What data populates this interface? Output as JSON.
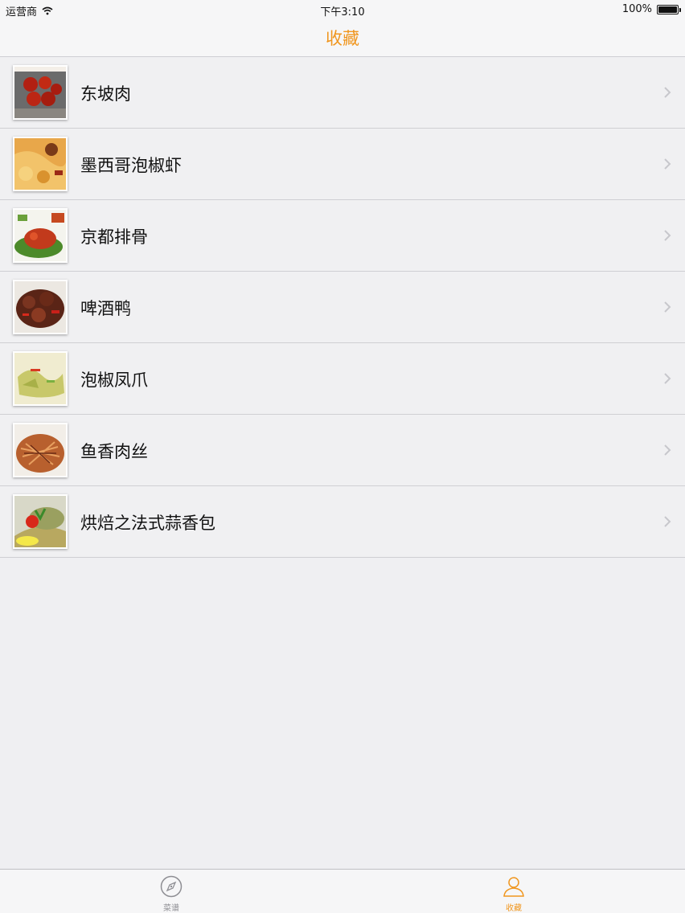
{
  "status_bar": {
    "carrier": "运营商",
    "time": "下午3:10",
    "battery_text": "100%",
    "battery_level": 1.0
  },
  "nav": {
    "title": "收藏",
    "accent_color": "#f0961e"
  },
  "favorites": [
    {
      "name": "东坡肉",
      "thumb_icon": "dongpo-pork-photo"
    },
    {
      "name": "墨西哥泡椒虾",
      "thumb_icon": "mexican-pepper-shrimp-photo"
    },
    {
      "name": "京都排骨",
      "thumb_icon": "kyoto-ribs-photo"
    },
    {
      "name": "啤酒鸭",
      "thumb_icon": "beer-duck-photo"
    },
    {
      "name": "泡椒凤爪",
      "thumb_icon": "pickled-pepper-chicken-feet-photo"
    },
    {
      "name": "鱼香肉丝",
      "thumb_icon": "yuxiang-pork-photo"
    },
    {
      "name": "烘焙之法式蒜香包",
      "thumb_icon": "french-garlic-bread-photo"
    }
  ],
  "tab_bar": {
    "tabs": [
      {
        "label": "菜谱",
        "icon": "compass-icon",
        "selected": false
      },
      {
        "label": "收藏",
        "icon": "person-icon",
        "selected": true
      }
    ],
    "selected_color": "#f0961e",
    "unselected_color": "#8e8e93"
  }
}
